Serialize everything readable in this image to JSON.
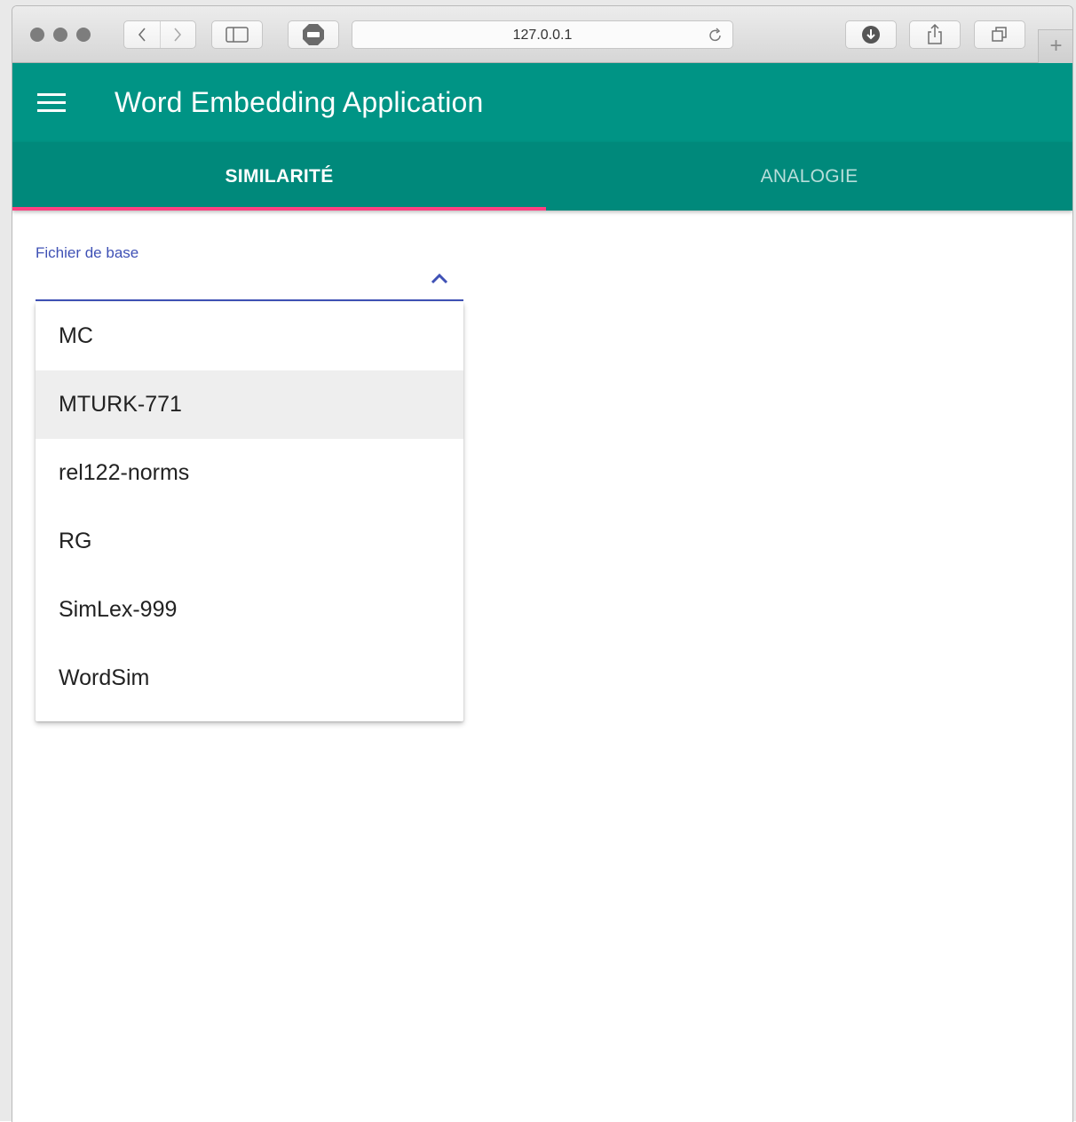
{
  "browser": {
    "url": "127.0.0.1",
    "new_tab_glyph": "+",
    "buttons": [
      "back-icon",
      "forward-icon",
      "sidebar-icon",
      "adblock-icon",
      "reload-icon",
      "download-icon",
      "share-icon",
      "tabs-icon"
    ]
  },
  "app": {
    "title": "Word Embedding Application",
    "menu_icon": "hamburger-menu-icon",
    "primary_color": "#009485",
    "tab_bar_color": "#00897b",
    "indicator_color": "#ff4081",
    "accent_color": "#3f51b5"
  },
  "tabs": [
    {
      "label": "SIMILARITÉ",
      "active": true
    },
    {
      "label": "ANALOGIE",
      "active": false
    }
  ],
  "form": {
    "label": "Fichier de base",
    "dropdown_open": true,
    "options": [
      {
        "label": "MC"
      },
      {
        "label": "MTURK-771",
        "highlighted": true
      },
      {
        "label": "rel122-norms"
      },
      {
        "label": "RG"
      },
      {
        "label": "SimLex-999"
      },
      {
        "label": "WordSim"
      }
    ]
  }
}
